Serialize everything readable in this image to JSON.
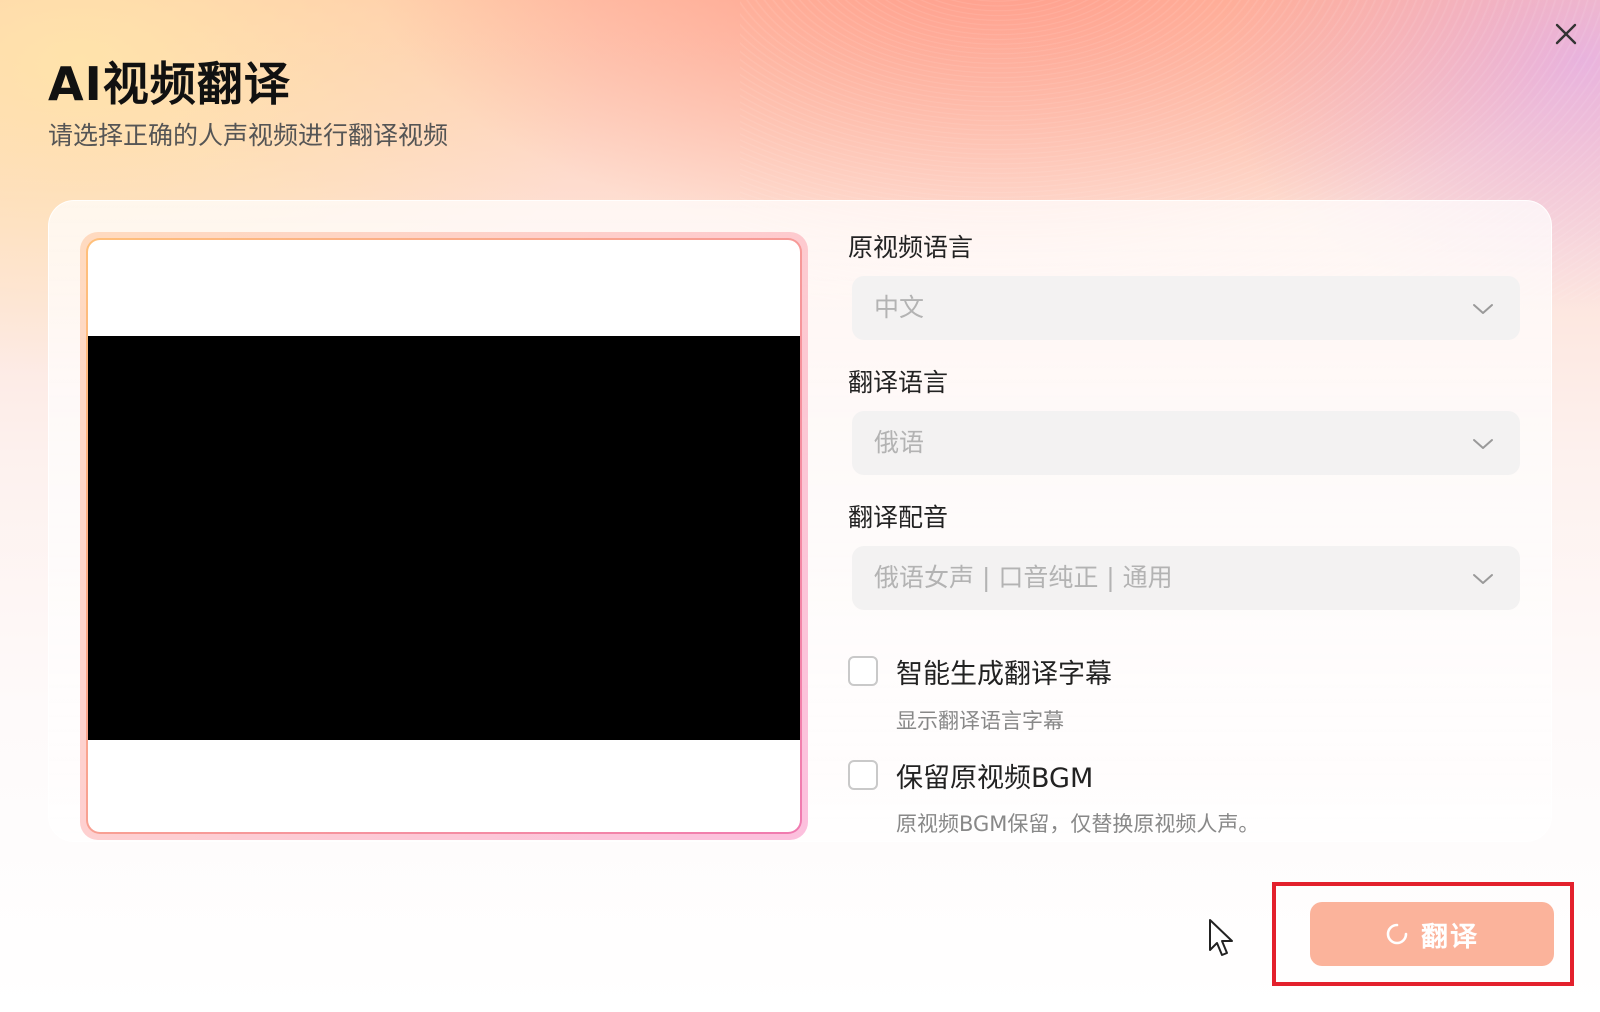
{
  "dialog": {
    "title": "AI视频翻译",
    "subtitle": "请选择正确的人声视频进行翻译视频"
  },
  "form": {
    "source_language": {
      "label": "原视频语言",
      "value": "中文"
    },
    "target_language": {
      "label": "翻译语言",
      "value": "俄语"
    },
    "dubbing": {
      "label": "翻译配音",
      "value": "俄语女声 | 口音纯正 | 通用"
    },
    "subtitles_option": {
      "label": "智能生成翻译字幕",
      "description": "显示翻译语言字幕",
      "checked": false
    },
    "bgm_option": {
      "label": "保留原视频BGM",
      "description": "原视频BGM保留，仅替换原视频人声。",
      "checked": false
    }
  },
  "actions": {
    "translate_label": "翻译",
    "translate_state": "loading",
    "translate_color": "#fbb39b"
  },
  "icons": {
    "close": "close-icon",
    "chevron": "chevron-down-icon",
    "spinner": "spinner-icon",
    "cursor": "mouse-pointer-icon"
  },
  "colors": {
    "highlight": "#e3202c",
    "button": "#fbb39b"
  }
}
